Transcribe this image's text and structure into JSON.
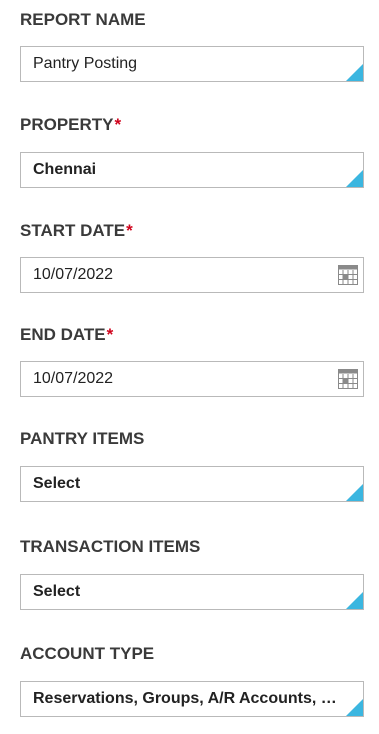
{
  "report_name": {
    "label": "REPORT NAME",
    "value": "Pantry Posting"
  },
  "property": {
    "label": "PROPERTY",
    "required_mark": "*",
    "value": "Chennai"
  },
  "start_date": {
    "label": "START DATE",
    "required_mark": "*",
    "value": "10/07/2022",
    "icon": "calendar-icon"
  },
  "end_date": {
    "label": "END DATE",
    "required_mark": "*",
    "value": "10/07/2022",
    "icon": "calendar-icon"
  },
  "pantry_items": {
    "label": "PANTRY ITEMS",
    "value": "Select"
  },
  "transaction_items": {
    "label": "TRANSACTION ITEMS",
    "value": "Select"
  },
  "account_type": {
    "label": "ACCOUNT TYPE",
    "value": "Reservations, Groups, A/R Accounts, Hou..."
  },
  "colors": {
    "accent": "#3bb6e0",
    "required": "#d0021b",
    "label": "#3a3a3a",
    "border": "#b9b9b9"
  }
}
